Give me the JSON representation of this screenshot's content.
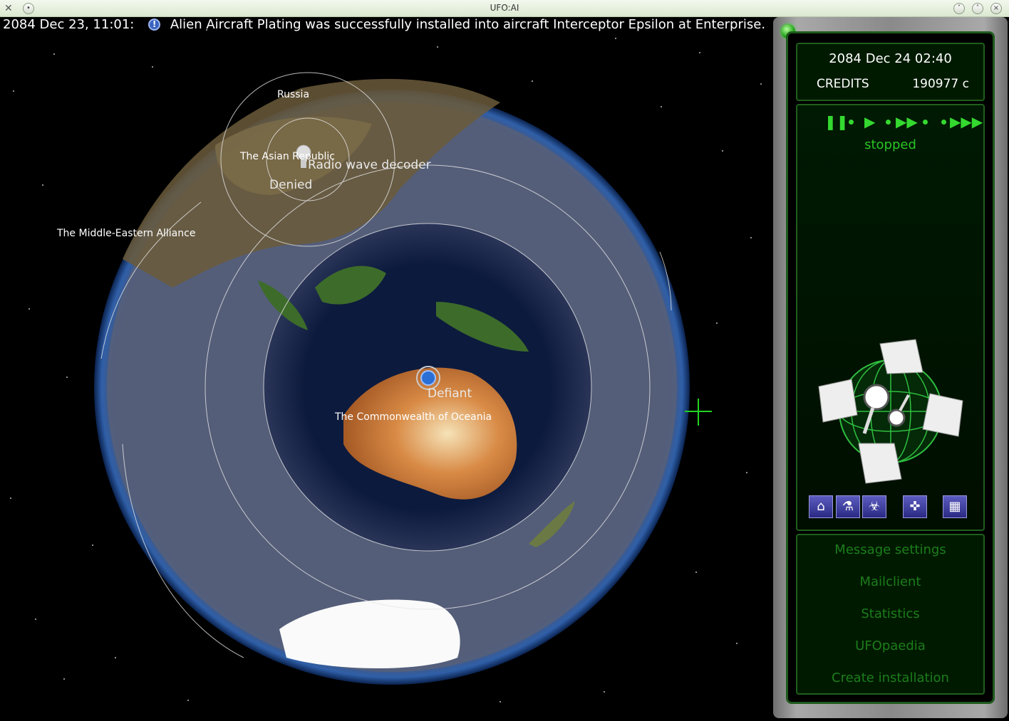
{
  "window": {
    "title": "UFO:AI"
  },
  "message": {
    "date": "2084 Dec 23, 11:01:",
    "icon": "info-icon",
    "text": "Alien Aircraft Plating was successfully installed into aircraft Interceptor Epsilon at Enterprise."
  },
  "map": {
    "labels": {
      "russia": "Russia",
      "asian_republic": "The Asian Republic",
      "middle_eastern": "The Middle-Eastern Alliance",
      "commonwealth": "The Commonwealth of Oceania"
    },
    "base": {
      "name": "Radio wave decoder",
      "status": "Denied"
    },
    "aircraft": {
      "name": "Defiant"
    }
  },
  "panel": {
    "date": "2084 Dec 24 02:40",
    "credits_label": "CREDITS",
    "credits_value": "190977 c",
    "speed_status": "stopped",
    "tool_icons": [
      "base-icon",
      "research-icon",
      "biohazard-icon",
      "map-icon",
      "installation-icon"
    ],
    "menu": [
      "Message settings",
      "Mailclient",
      "Statistics",
      "UFOpaedia",
      "Create installation"
    ]
  },
  "colors": {
    "accent": "#2ac226",
    "menu": "#1c7d1b",
    "panel_border": "#1f5f1c"
  }
}
